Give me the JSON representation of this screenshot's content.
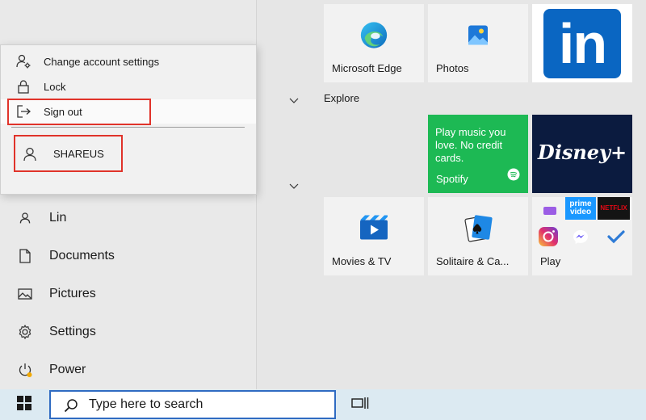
{
  "account_menu": {
    "change_settings": "Change account settings",
    "lock": "Lock",
    "sign_out": "Sign out",
    "user": "SHAREUS"
  },
  "nav": [
    {
      "label": "Lin",
      "icon": "person-icon"
    },
    {
      "label": "Documents",
      "icon": "document-icon"
    },
    {
      "label": "Pictures",
      "icon": "pictures-icon"
    },
    {
      "label": "Settings",
      "icon": "gear-icon"
    },
    {
      "label": "Power",
      "icon": "power-icon"
    }
  ],
  "groups": {
    "explore": "Explore"
  },
  "tiles": {
    "edge": "Microsoft Edge",
    "photos": "Photos",
    "linkedin_logo": "in",
    "spotify_text": "Play music you love. No credit cards.",
    "spotify": "Spotify",
    "disney_logo": "Disney+",
    "movies": "Movies & TV",
    "solitaire": "Solitaire & Ca...",
    "play": "Play",
    "prime_logo": "prime video",
    "netflix_logo": "NETFLIX"
  },
  "taskbar": {
    "search_placeholder": "Type here to search"
  },
  "colors": {
    "highlight": "#e0332a",
    "linkedin": "#0a66c2",
    "spotify": "#1db954",
    "disney": "#0b1b3f",
    "taskbar": "#dceaf2",
    "search_border": "#2f6bc2"
  }
}
